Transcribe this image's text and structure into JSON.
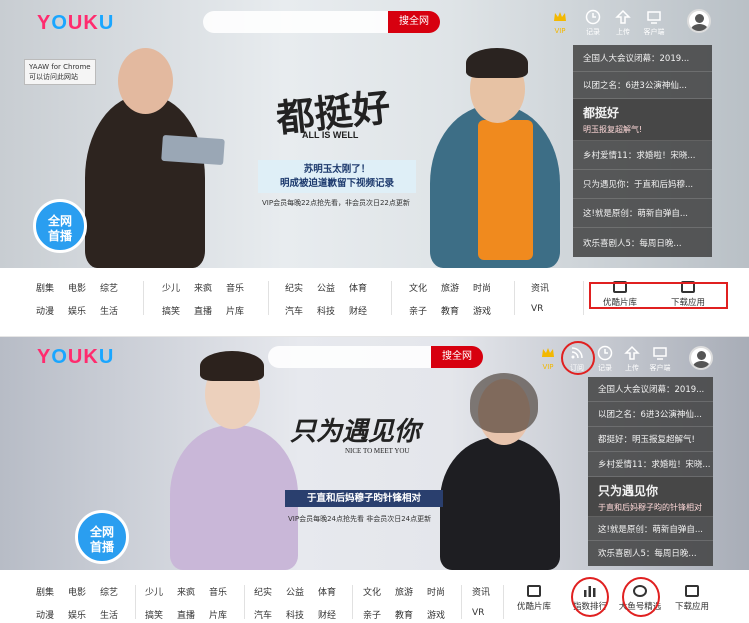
{
  "panel1": {
    "logo": "YOUKU",
    "search_button": "搜全网",
    "top_icons": [
      "VIP",
      "记录",
      "上传",
      "客户端"
    ],
    "extension_tip": [
      "YAAW for Chrome",
      "可以访问此网站"
    ],
    "show_title": "都挺好",
    "show_subtitle": "ALL IS WELL",
    "tagline": [
      "苏明玉太刚了！",
      "明成被迫道歉留下视频记录"
    ],
    "vip_note": "VIP会员每晚22点抢先看，非会员次日22点更新",
    "badge": [
      "全网",
      "首播"
    ],
    "side_list": [
      "全国人大会议闭幕：2019...",
      "以团之名：6进3公演神仙...",
      {
        "title": "都挺好",
        "subtitle": "明玉报复超解气!"
      },
      "乡村爱情11：求婚啦！宋晓...",
      "只为遇见你：于直和后妈穆...",
      "这!就是原创：萌新自弹自...",
      "欢乐喜剧人5：每周日晚..."
    ],
    "nav_groups": [
      [
        "剧集",
        "电影",
        "综艺",
        "动漫",
        "娱乐",
        "生活"
      ],
      [
        "少儿",
        "来疯",
        "音乐",
        "搞笑",
        "直播",
        "片库"
      ],
      [
        "纪实",
        "公益",
        "体育",
        "汽车",
        "科技",
        "财经"
      ],
      [
        "文化",
        "旅游",
        "时尚",
        "亲子",
        "教育",
        "游戏"
      ],
      [
        "资讯",
        "",
        "",
        "VR",
        "",
        ""
      ]
    ],
    "nav_icons": [
      "优酷片库",
      "下载应用"
    ]
  },
  "panel2": {
    "logo": "YOUKU",
    "search_button": "搜全网",
    "top_icons": [
      "VIP",
      "订阅",
      "记录",
      "上传",
      "客户端"
    ],
    "show_title": "只为遇见你",
    "show_subtitle": "NICE TO MEET YOU",
    "tagline": [
      "于直和后妈穆子昀针锋相对"
    ],
    "vip_note": "VIP会员每晚24点抢先看 非会员次日24点更新",
    "badge": [
      "全网",
      "首播"
    ],
    "side_list": [
      "全国人大会议闭幕：2019...",
      "以团之名：6进3公演神仙...",
      "都挺好：明玉报复超解气!",
      "乡村爱情11：求婚啦！宋晓...",
      {
        "title": "只为遇见你",
        "subtitle": "于直和后妈穆子昀的针锋相对"
      },
      "这!就是原创：萌新自弹自...",
      "欢乐喜剧人5：每周日晚..."
    ],
    "nav_groups": [
      [
        "剧集",
        "电影",
        "综艺",
        "动漫",
        "娱乐",
        "生活"
      ],
      [
        "少儿",
        "来疯",
        "音乐",
        "搞笑",
        "直播",
        "片库"
      ],
      [
        "纪实",
        "公益",
        "体育",
        "汽车",
        "科技",
        "财经"
      ],
      [
        "文化",
        "旅游",
        "时尚",
        "亲子",
        "教育",
        "游戏"
      ],
      [
        "资讯",
        "",
        "",
        "VR",
        "",
        ""
      ]
    ],
    "nav_icons": [
      "优酷片库",
      "指数排行",
      "大鱼号精选",
      "下载应用"
    ]
  },
  "colors": {
    "accent_red": "#d7000f",
    "highlight": "#e02020",
    "logo_pink": "#ff2b6e",
    "logo_blue": "#1aa6ff"
  }
}
